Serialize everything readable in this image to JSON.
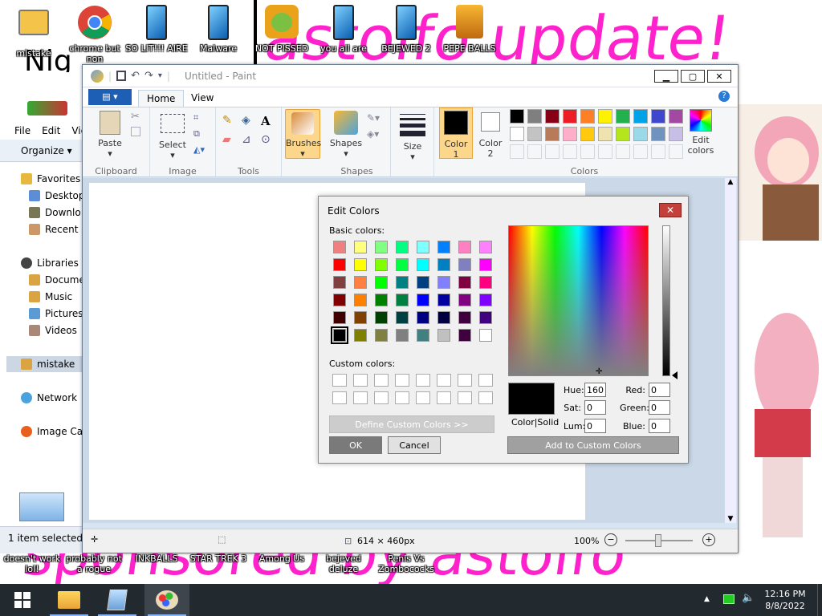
{
  "desktop": {
    "icons": [
      {
        "label": "mistake",
        "icon": "folder-computer-icon"
      },
      {
        "label": "chrome but",
        "label2": "non",
        "icon": "chrome-icon"
      },
      {
        "label": "SO LIT!!! AIRE",
        "icon": "tablet-icon"
      },
      {
        "label": "Malware",
        "icon": "tablet-icon"
      },
      {
        "label": "NOT PISSED",
        "icon": "bad-piggies-icon"
      },
      {
        "label": "you all are",
        "icon": "tablet-icon"
      },
      {
        "label": "BEJEWED 2",
        "icon": "tablet-icon"
      },
      {
        "label": "PEPE BALLS",
        "icon": "bejeweled-icon"
      }
    ],
    "bottom_icons": [
      {
        "label": "doesn't work",
        "label2": "lol!"
      },
      {
        "label": "probably not",
        "label2": "a rogue"
      },
      {
        "label": "INKBALLS"
      },
      {
        "label": "STAR TREK 3"
      },
      {
        "label": "Among Us"
      },
      {
        "label": "bejeved",
        "label2": "deluze"
      },
      {
        "label": "Penis Vs",
        "label2": "Zombococks"
      }
    ],
    "wallpaper_top": "astolfo update!",
    "wallpaper_bottom": "sponsored by astolfo",
    "nig_text": "Nig"
  },
  "explorer": {
    "menu": [
      "File",
      "Edit",
      "Vie"
    ],
    "organize": "Organize",
    "nav": [
      "Favorites",
      "Desktop",
      "Downlo",
      "Recent P",
      "Libraries",
      "Docume",
      "Music",
      "Pictures",
      "Videos",
      "mistake",
      "Network",
      "Image Cat"
    ],
    "status": "1 item selected"
  },
  "paint": {
    "title": "Untitled - Paint",
    "tabs": {
      "home": "Home",
      "view": "View"
    },
    "groups": {
      "clipboard": "Clipboard",
      "image": "Image",
      "tools": "Tools",
      "shapes": "Shapes",
      "colors": "Colors"
    },
    "buttons": {
      "paste": "Paste",
      "select": "Select",
      "brushes": "Brushes",
      "shapes": "Shapes",
      "size": "Size",
      "color1": "Color",
      "color1_n": "1",
      "color2": "Color",
      "color2_n": "2",
      "edit_colors": "Edit",
      "edit_colors2": "colors"
    },
    "palette_row1": [
      "#000000",
      "#7f7f7f",
      "#880015",
      "#ed1c24",
      "#ff7f27",
      "#fff200",
      "#22b14c",
      "#00a2e8",
      "#3f48cc",
      "#a349a4"
    ],
    "palette_row2": [
      "#ffffff",
      "#c3c3c3",
      "#b97a57",
      "#ffaec9",
      "#ffc90e",
      "#efe4b0",
      "#b5e61d",
      "#99d9ea",
      "#7092be",
      "#c8bfe7"
    ],
    "status": {
      "dimensions": "614 × 460px",
      "zoom": "100%"
    }
  },
  "dialog": {
    "title": "Edit Colors",
    "basic_label": "Basic colors:",
    "custom_label": "Custom colors:",
    "define_button": "Define Custom Colors >>",
    "ok": "OK",
    "cancel": "Cancel",
    "color_solid": "Color|Solid",
    "add_custom": "Add to Custom Colors",
    "hue_label": "Hue:",
    "hue": "160",
    "sat_label": "Sat:",
    "sat": "0",
    "lum_label": "Lum:",
    "lum": "0",
    "red_label": "Red:",
    "red": "0",
    "green_label": "Green:",
    "green": "0",
    "blue_label": "Blue:",
    "blue": "0",
    "basic_colors": [
      [
        "#f08080",
        "#ffff80",
        "#80ff80",
        "#00ff80",
        "#80ffff",
        "#0080ff",
        "#ff80c0",
        "#ff80ff"
      ],
      [
        "#ff0000",
        "#ffff00",
        "#80ff00",
        "#00ff40",
        "#00ffff",
        "#0080c0",
        "#8080c0",
        "#ff00ff"
      ],
      [
        "#804040",
        "#ff8040",
        "#00ff00",
        "#008080",
        "#004080",
        "#8080ff",
        "#800040",
        "#ff0080"
      ],
      [
        "#800000",
        "#ff8000",
        "#008000",
        "#008040",
        "#0000ff",
        "#0000a0",
        "#800080",
        "#8000ff"
      ],
      [
        "#400000",
        "#804000",
        "#004000",
        "#004040",
        "#000080",
        "#000040",
        "#400040",
        "#400080"
      ],
      [
        "#000000",
        "#808000",
        "#808040",
        "#808080",
        "#408080",
        "#c0c0c0",
        "#400040",
        "#ffffff"
      ]
    ]
  },
  "taskbar": {
    "time": "12:16 PM",
    "date": "8/8/2022"
  }
}
